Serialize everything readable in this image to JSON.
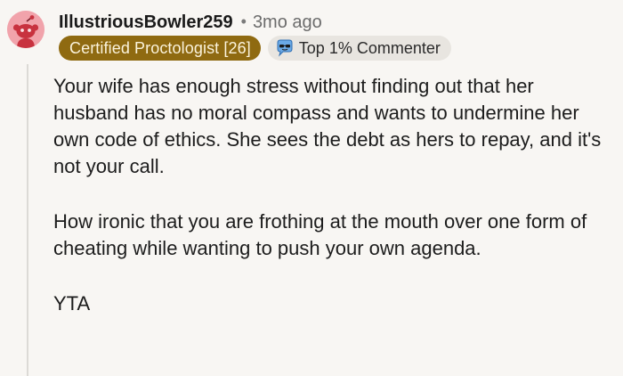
{
  "comment": {
    "username": "IllustriousBowler259",
    "separator": "•",
    "time_ago": "3mo ago",
    "flair_certified": "Certified Proctologist [26]",
    "flair_top": "Top 1% Commenter",
    "paragraphs": [
      "Your wife has enough stress without finding out that her husband has no moral compass and wants to undermine her own code of ethics. She sees the debt as hers to repay, and it's not your call.",
      "How ironic that you are frothing at the mouth over one form of cheating while wanting to push your own agenda.",
      "YTA"
    ]
  },
  "icons": {
    "avatar": "snoo-avatar-icon",
    "top_commenter": "top-commenter-badge-icon"
  },
  "colors": {
    "background": "#f8f6f3",
    "flair_certified_bg": "#8f6a11",
    "flair_top_bg": "#e8e5e0",
    "avatar_bg": "#f1a3ab",
    "thread_line": "#dcdad6"
  }
}
